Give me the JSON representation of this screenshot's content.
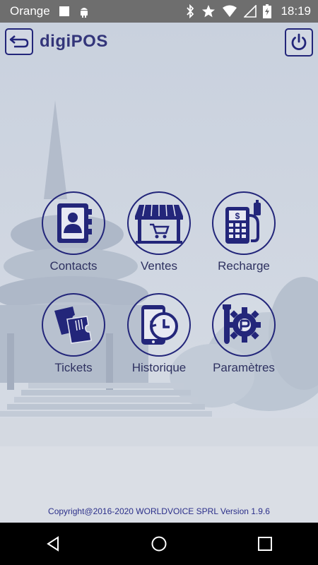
{
  "status_bar": {
    "carrier": "Orange",
    "time": "18:19",
    "icons": [
      "square-notification-icon",
      "android-icon",
      "bluetooth-icon",
      "star-icon",
      "wifi-icon",
      "no-sim-icon",
      "battery-charging-icon"
    ]
  },
  "app_bar": {
    "title": "digiPOS",
    "back_icon": "back-arrow-icon",
    "power_icon": "power-icon"
  },
  "menu": {
    "items": [
      {
        "label": "Contacts",
        "icon": "contacts-book-icon"
      },
      {
        "label": "Ventes",
        "icon": "shop-cart-icon"
      },
      {
        "label": "Recharge",
        "icon": "pos-terminal-fuel-icon"
      },
      {
        "label": "Tickets",
        "icon": "tickets-icon"
      },
      {
        "label": "Historique",
        "icon": "phone-history-icon"
      },
      {
        "label": "Paramètres",
        "icon": "settings-gear-icon"
      }
    ]
  },
  "footer": {
    "copyright": "Copyright@2016-2020 WORLDVOICE SPRL Version 1.9.6"
  },
  "colors": {
    "accent": "#23267a",
    "status_bar": "#6e6e6e",
    "background": "#ccd3df"
  }
}
